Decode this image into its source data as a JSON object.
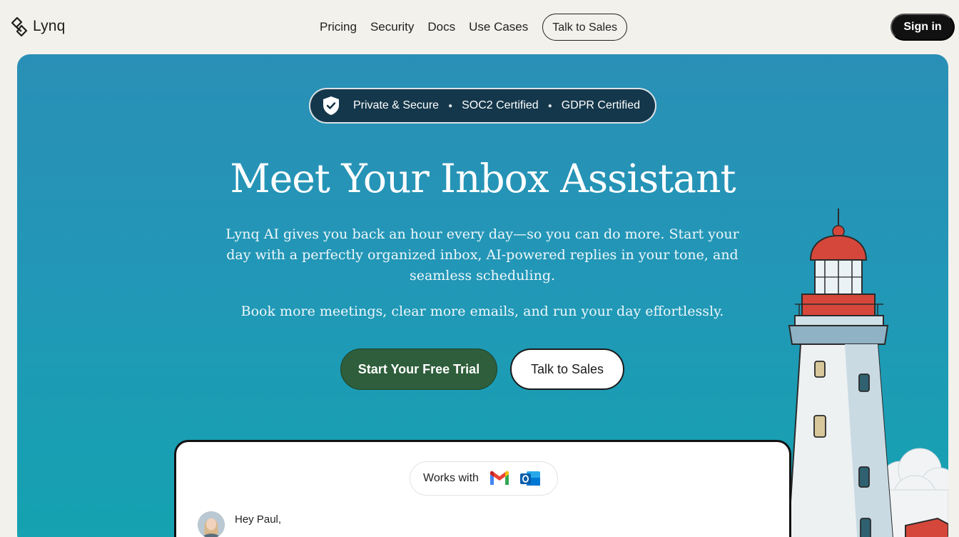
{
  "brand": {
    "name": "Lynq"
  },
  "nav": {
    "links": [
      "Pricing",
      "Security",
      "Docs",
      "Use Cases"
    ],
    "talk_to_sales": "Talk to Sales",
    "sign_in": "Sign in"
  },
  "hero": {
    "badges": [
      "Private & Secure",
      "SOC2 Certified",
      "GDPR Certified"
    ],
    "title": "Meet Your Inbox Assistant",
    "description": "Lynq AI gives you back an hour every day—so you can do more. Start your day with a perfectly organized inbox,  AI-powered replies in your tone, and seamless scheduling.",
    "subtext": "Book more meetings, clear more emails, and run your day effortlessly.",
    "cta_primary": "Start Your Free Trial",
    "cta_secondary": "Talk to Sales"
  },
  "preview_card": {
    "works_with": "Works with",
    "integrations": [
      "gmail-icon",
      "outlook-icon"
    ],
    "greeting": "Hey Paul,"
  },
  "colors": {
    "page_bg": "#f2f1ec",
    "hero_blue": "#2292b6",
    "cta_green": "#2e5e3b",
    "signin_bg": "#111111",
    "badge_bg": "#123042"
  }
}
